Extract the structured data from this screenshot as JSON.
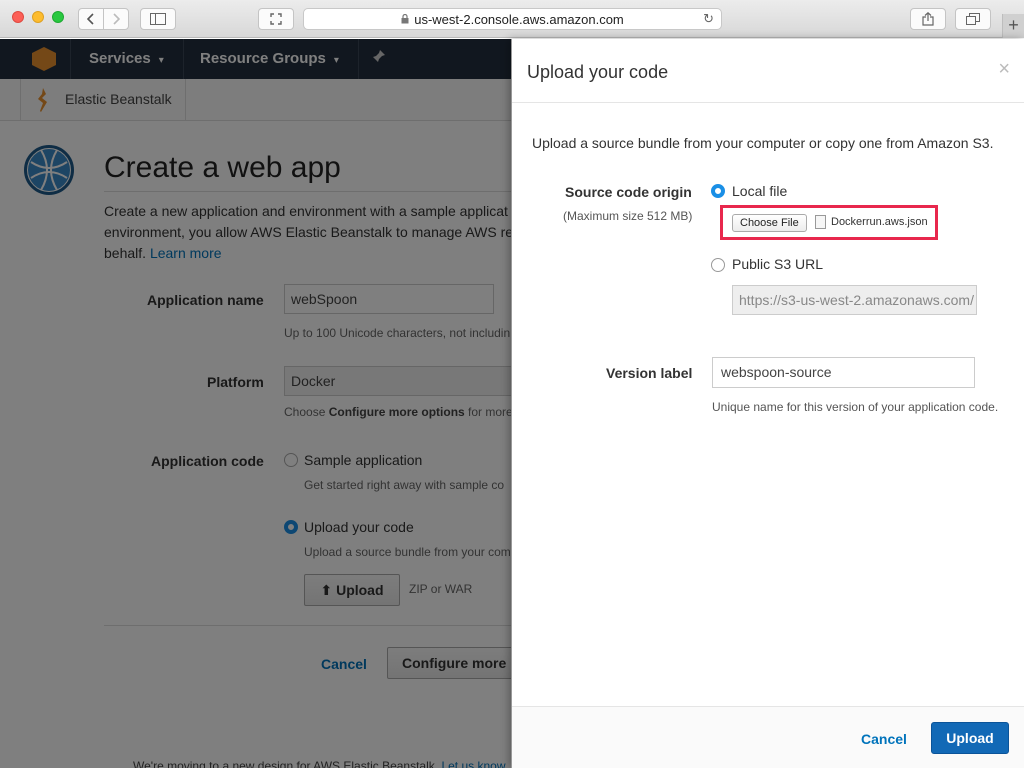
{
  "browser": {
    "url": "us-west-2.console.aws.amazon.com",
    "new_tab": "+"
  },
  "aws_nav": {
    "services": "Services",
    "resource_groups": "Resource Groups"
  },
  "subnav": {
    "service": "Elastic Beanstalk"
  },
  "page": {
    "title": "Create a web app",
    "description": "Create a new application and environment with a sample applicat",
    "description2": "environment, you allow AWS Elastic Beanstalk to manage AWS re",
    "description3": "behalf.",
    "learn_more": "Learn more",
    "app_name_label": "Application name",
    "app_name_value": "webSpoon",
    "app_name_help": "Up to 100 Unicode characters, not includin",
    "platform_label": "Platform",
    "platform_value": "Docker",
    "platform_help_pre": "Choose ",
    "platform_help_bold": "Configure more options",
    "platform_help_post": " for more",
    "app_code_label": "Application code",
    "sample_app": "Sample application",
    "sample_app_help": "Get started right away with sample co",
    "upload_code": "Upload your code",
    "upload_code_help": "Upload a source bundle from your com",
    "upload_button": "Upload",
    "zip_or_war": "ZIP or WAR",
    "cancel": "Cancel",
    "configure_more": "Configure more",
    "footer_text": "We're moving to a new design for AWS Elastic Beanstalk.",
    "footer_link": "Let us know"
  },
  "modal": {
    "title": "Upload your code",
    "close": "×",
    "intro": "Upload a source bundle from your computer or copy one from Amazon S3.",
    "source_origin_label": "Source code origin",
    "source_origin_sublabel": "(Maximum size 512 MB)",
    "local_file": "Local file",
    "choose_file": "Choose File",
    "file_name": "Dockerrun.aws.json",
    "public_s3_url": "Public S3 URL",
    "s3_placeholder": "https://s3-us-west-2.amazonaws.com/",
    "version_label": "Version label",
    "version_value": "webspoon-source",
    "version_help": "Unique name for this version of your application code.",
    "cancel": "Cancel",
    "upload": "Upload"
  },
  "colors": {
    "aws_nav": "#232f3e",
    "link": "#0073bb",
    "primary_button": "#1269b6",
    "highlight": "#e8284d",
    "radio_selected": "#1a8fe6"
  }
}
